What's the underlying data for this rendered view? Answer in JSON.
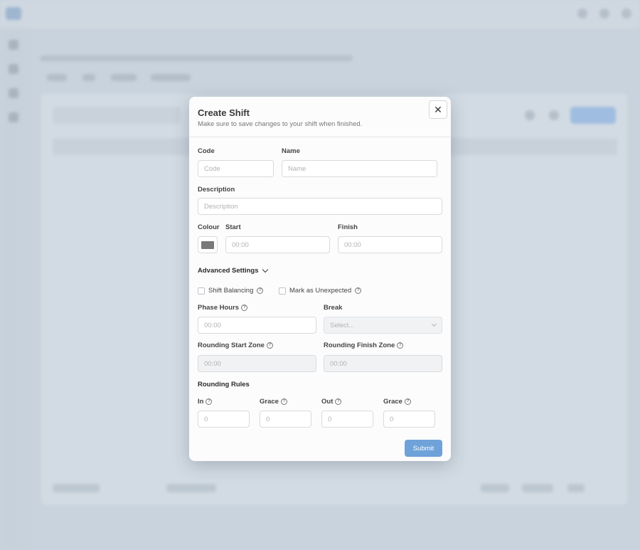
{
  "modal": {
    "title": "Create Shift",
    "subtitle": "Make sure to save changes to your shift when finished.",
    "close_glyph": "✕",
    "fields": {
      "code": {
        "label": "Code",
        "placeholder": "Code"
      },
      "name": {
        "label": "Name",
        "placeholder": "Name"
      },
      "description": {
        "label": "Description",
        "placeholder": "Description"
      },
      "colour": {
        "label": "Colour",
        "value": "#797979"
      },
      "start": {
        "label": "Start",
        "placeholder": "00:00"
      },
      "finish": {
        "label": "Finish",
        "placeholder": "00:00"
      }
    },
    "advanced": {
      "label": "Advanced Settings",
      "expanded": true,
      "shift_balancing": {
        "label": "Shift Balancing",
        "checked": false
      },
      "mark_unexpected": {
        "label": "Mark as Unexpected",
        "checked": false
      },
      "phase_hours": {
        "label": "Phase Hours",
        "placeholder": "00:00"
      },
      "break": {
        "label": "Break",
        "placeholder": "Select..."
      },
      "rounding_start_zone": {
        "label": "Rounding Start Zone",
        "placeholder": "00:00"
      },
      "rounding_finish_zone": {
        "label": "Rounding Finish Zone",
        "placeholder": "00:00"
      }
    },
    "rounding_rules": {
      "title": "Rounding Rules",
      "in": {
        "label": "In",
        "placeholder": "0"
      },
      "grace_in": {
        "label": "Grace",
        "placeholder": "0"
      },
      "out": {
        "label": "Out",
        "placeholder": "0"
      },
      "grace_out": {
        "label": "Grace",
        "placeholder": "0"
      }
    },
    "help_glyph": "?",
    "submit_label": "Submit"
  },
  "colors": {
    "accent": "#6fa2d8",
    "overlay": "#c9d3dd",
    "modal_bg": "#fcfcfc"
  }
}
